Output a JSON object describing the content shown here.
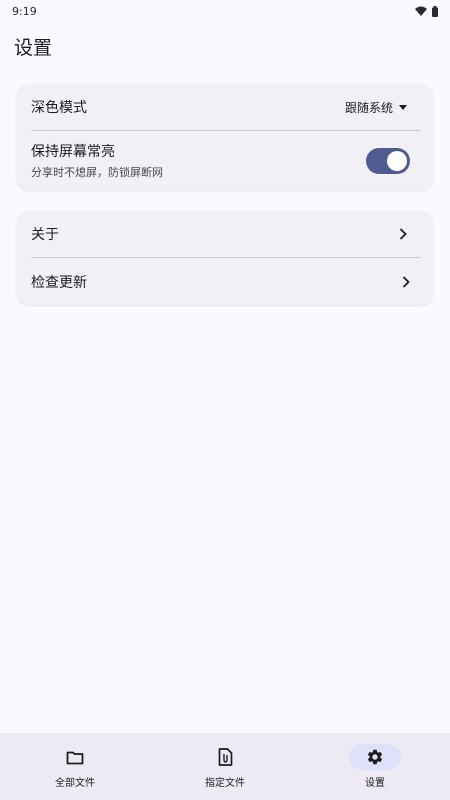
{
  "status_bar": {
    "time": "9:19"
  },
  "header": {
    "title": "设置"
  },
  "display_card": {
    "dark_mode_label": "深色模式",
    "dark_mode_value": "跟随系统",
    "keep_screen_label": "保持屏幕常亮",
    "keep_screen_desc": "分享时不熄屏，防锁屏断网",
    "keep_screen_on": true
  },
  "info_card": {
    "about_label": "关于",
    "check_update_label": "检查更新"
  },
  "bottom_nav": {
    "items": [
      {
        "label": "全部文件",
        "icon": "folder-icon"
      },
      {
        "label": "指定文件",
        "icon": "file-icon"
      },
      {
        "label": "设置",
        "icon": "gear-icon"
      }
    ],
    "active": "设置"
  },
  "colors": {
    "accent": "#4f5b91",
    "background": "#fbf8fe",
    "card": "#f3eff7",
    "nav_active": "#dde1f9"
  }
}
